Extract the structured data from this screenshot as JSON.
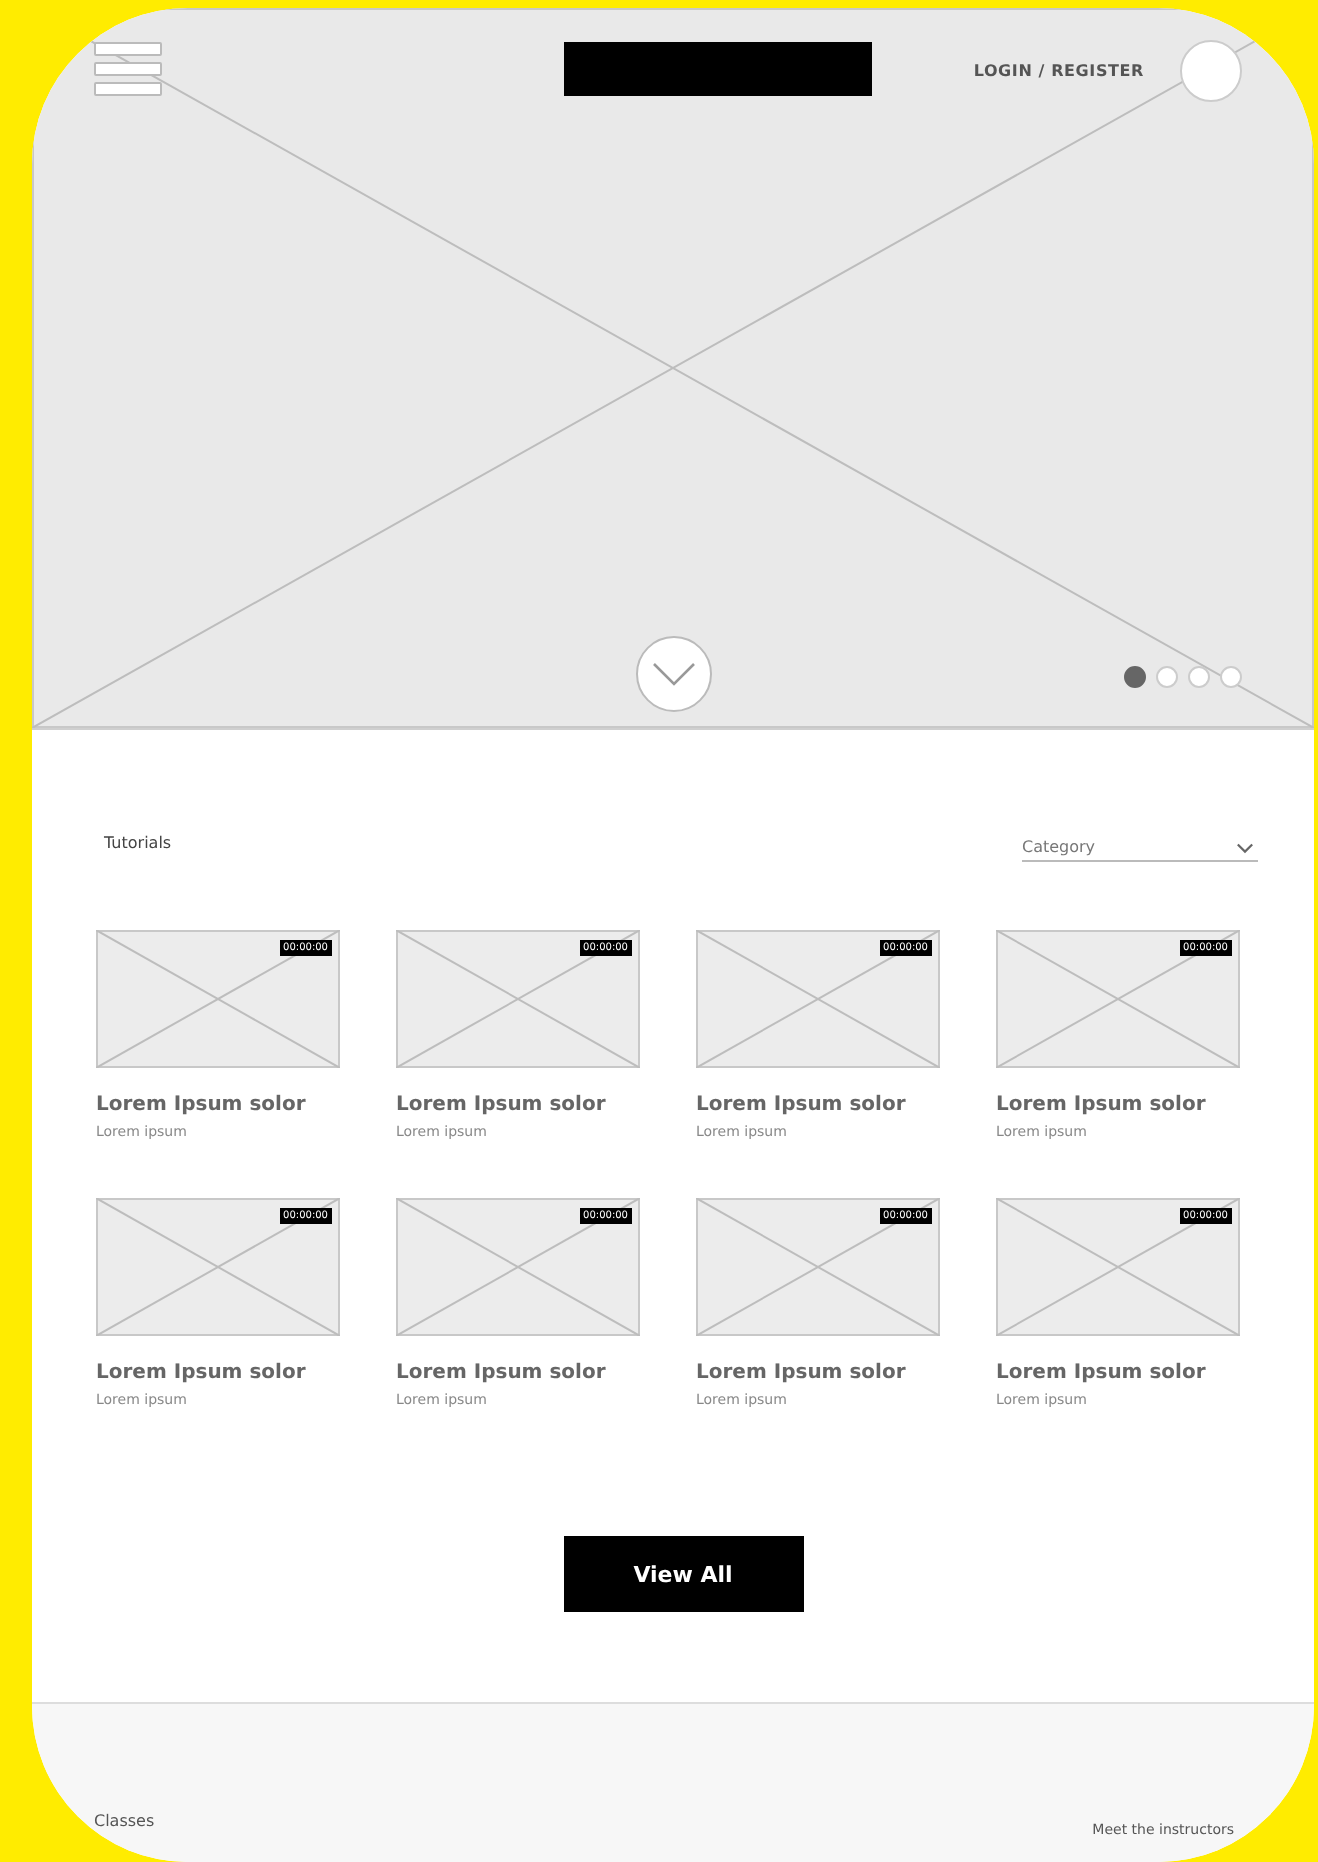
{
  "header": {
    "login": "LOGIN / REGISTER"
  },
  "hero": {
    "slides": [
      {
        "selected": true
      },
      {
        "selected": false
      },
      {
        "selected": false
      },
      {
        "selected": false
      }
    ]
  },
  "tutorials": {
    "title": "Tutorials",
    "category": {
      "placeholder": "Category"
    },
    "cards": [
      {
        "duration": "00:00:00",
        "title": "Lorem Ipsum solor",
        "subtitle": "Lorem ipsum"
      },
      {
        "duration": "00:00:00",
        "title": "Lorem Ipsum solor",
        "subtitle": "Lorem ipsum"
      },
      {
        "duration": "00:00:00",
        "title": "Lorem Ipsum solor",
        "subtitle": "Lorem ipsum"
      },
      {
        "duration": "00:00:00",
        "title": "Lorem Ipsum solor",
        "subtitle": "Lorem ipsum"
      },
      {
        "duration": "00:00:00",
        "title": "Lorem Ipsum solor",
        "subtitle": "Lorem ipsum"
      },
      {
        "duration": "00:00:00",
        "title": "Lorem Ipsum solor",
        "subtitle": "Lorem ipsum"
      },
      {
        "duration": "00:00:00",
        "title": "Lorem Ipsum solor",
        "subtitle": "Lorem ipsum"
      },
      {
        "duration": "00:00:00",
        "title": "Lorem Ipsum solor",
        "subtitle": "Lorem ipsum"
      }
    ],
    "button": "View All"
  },
  "classes": {
    "title": "Classes",
    "link": "Meet the instructors"
  }
}
